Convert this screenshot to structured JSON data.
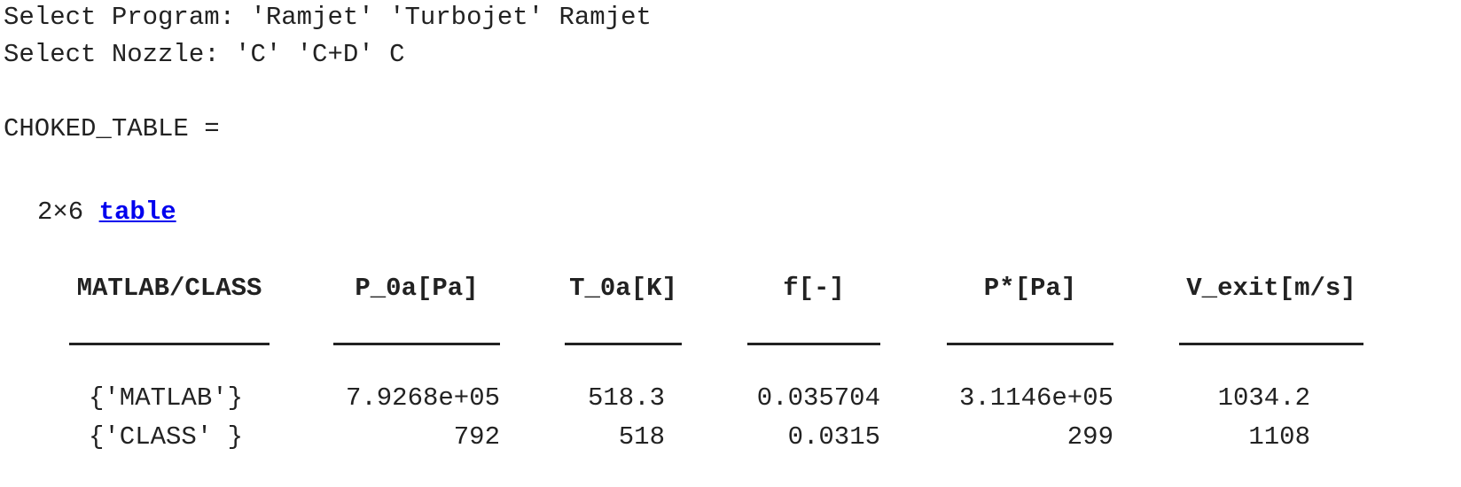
{
  "console": {
    "program_prompt": "Select Program: 'Ramjet' 'Turbojet' Ramjet",
    "nozzle_prompt": "Select Nozzle: 'C' 'C+D' C",
    "var_display": "CHOKED_TABLE ="
  },
  "table": {
    "size_text": "2×6",
    "link_label": "table",
    "columns": [
      "MATLAB/CLASS",
      "P_0a[Pa]",
      "T_0a[K]",
      "f[-]",
      "P*[Pa]",
      "V_exit[m/s]"
    ],
    "rows": [
      [
        "{'MATLAB'}",
        "7.9268e+05",
        "518.3",
        "0.035704",
        "3.1146e+05",
        "1034.2"
      ],
      [
        "{'CLASS' }",
        "792",
        "518",
        "0.0315",
        "299",
        "1108"
      ]
    ]
  }
}
